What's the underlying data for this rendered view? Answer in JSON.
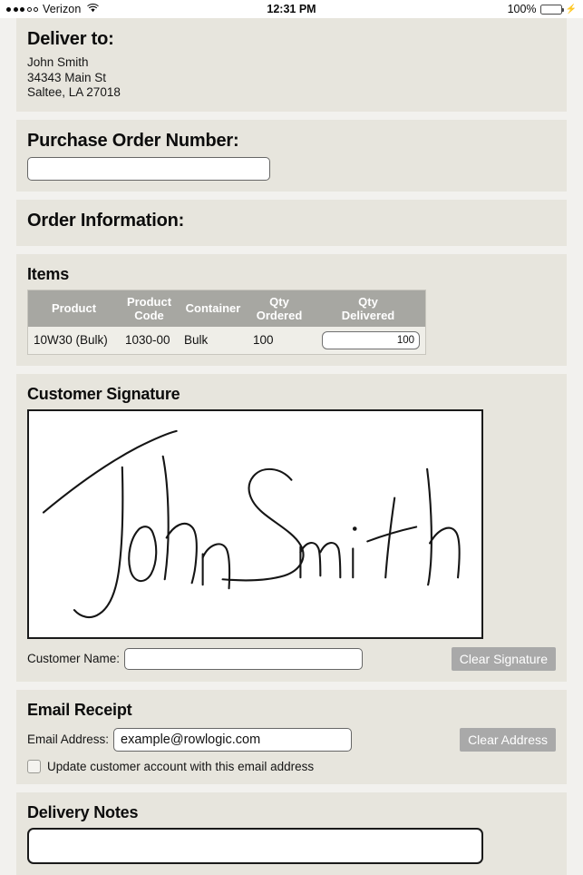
{
  "status_bar": {
    "carrier": "Verizon",
    "signal_filled": 3,
    "signal_empty": 2,
    "wifi_icon": "wifi-icon",
    "time": "12:31 PM",
    "battery_percent": "100%",
    "battery_level": 100,
    "battery_color": "#4cd964",
    "charging": true
  },
  "deliver_to": {
    "heading": "Deliver to:",
    "name": "John Smith",
    "street": "34343 Main St",
    "city_state_zip": "Saltee, LA 27018"
  },
  "purchase_order": {
    "heading": "Purchase Order Number:",
    "value": "",
    "placeholder": ""
  },
  "order_information": {
    "heading": "Order Information:"
  },
  "items": {
    "heading": "Items",
    "columns": [
      "Product",
      "Product Code",
      "Container",
      "Qty Ordered",
      "Qty Delivered"
    ],
    "columns_wrapped": [
      [
        "Product",
        ""
      ],
      [
        "Product",
        "Code"
      ],
      [
        "Container",
        ""
      ],
      [
        "Qty",
        "Ordered"
      ],
      [
        "Qty",
        "Delivered"
      ]
    ],
    "rows": [
      {
        "product": "10W30 (Bulk)",
        "product_code": "1030-00",
        "container": "Bulk",
        "qty_ordered": "100",
        "qty_delivered": "100"
      }
    ],
    "header_bg": "#a7a7a2"
  },
  "customer_signature": {
    "heading": "Customer Signature",
    "signature_text": "John Smith",
    "name_label": "Customer Name:",
    "name_value": "",
    "clear_button": "Clear Signature"
  },
  "email_receipt": {
    "heading": "Email Receipt",
    "address_label": "Email Address:",
    "address_value": "example@rowlogic.com",
    "clear_button": "Clear Address",
    "checkbox_label": "Update customer account with this email address",
    "checkbox_checked": false
  },
  "delivery_notes": {
    "heading": "Delivery Notes",
    "value": "",
    "placeholder": ""
  },
  "theme": {
    "page_bg": "#f2f1ee",
    "panel_bg": "#e7e5dd",
    "button_gray": "#a9a9a9",
    "accent_green": "#4cd964"
  }
}
